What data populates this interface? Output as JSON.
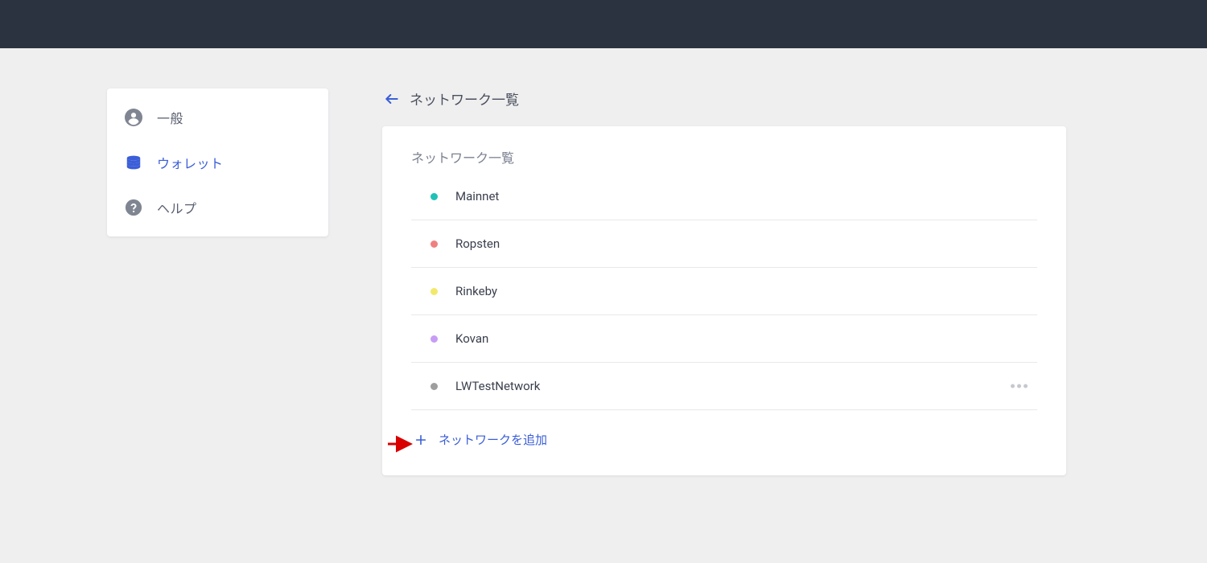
{
  "sidebar": {
    "items": [
      {
        "label": "一般",
        "active": false
      },
      {
        "label": "ウォレット",
        "active": true
      },
      {
        "label": "ヘルプ",
        "active": false
      }
    ]
  },
  "main": {
    "page_title": "ネットワーク一覧",
    "card_title": "ネットワーク一覧",
    "networks": [
      {
        "name": "Mainnet",
        "dot_color": "#1fc1b7",
        "show_more": false
      },
      {
        "name": "Ropsten",
        "dot_color": "#f08080",
        "show_more": false
      },
      {
        "name": "Rinkeby",
        "dot_color": "#f2e96b",
        "show_more": false
      },
      {
        "name": "Kovan",
        "dot_color": "#c89cf5",
        "show_more": false
      },
      {
        "name": "LWTestNetwork",
        "dot_color": "#9e9e9e",
        "show_more": true
      }
    ],
    "add_label": "ネットワークを追加"
  },
  "annotation": {
    "arrow_color": "#d80000"
  }
}
